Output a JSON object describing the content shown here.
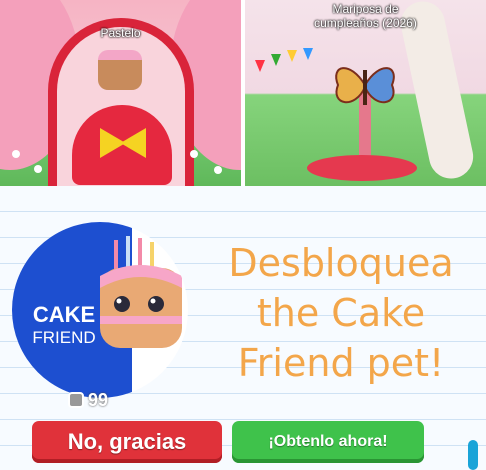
{
  "screens": {
    "left": {
      "caption": "Pastelo"
    },
    "right": {
      "caption_line1": "Mariposa de",
      "caption_line2": "cumpleaños (2026)"
    }
  },
  "promo": {
    "badge_line1": "CAKE",
    "badge_line2": "FRIEND",
    "title_line1": "Desbloquea",
    "title_line2": "the Cake",
    "title_line3": "Friend pet!",
    "price": "99",
    "decline_label": "No, gracias",
    "accept_label": "¡Obtenlo ahora!"
  },
  "colors": {
    "title": "#f3a64a",
    "decline": "#e0323a",
    "accept": "#3fc24b",
    "badge_blue": "#1d4fd0"
  },
  "icons": [
    "robux-icon",
    "cake-pet-icon",
    "butterfly-icon"
  ]
}
